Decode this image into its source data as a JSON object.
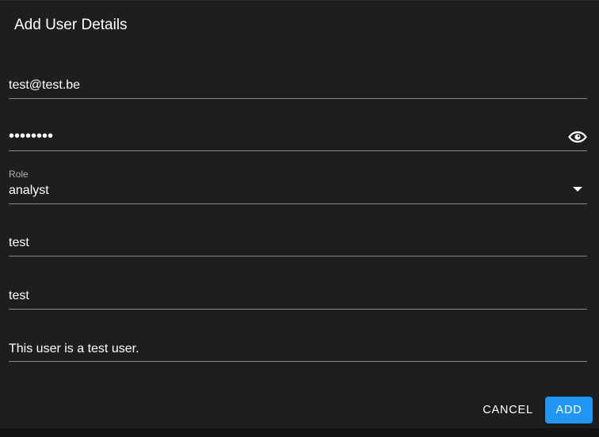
{
  "dialog": {
    "title": "Add User Details"
  },
  "form": {
    "email": {
      "value": "test@test.be"
    },
    "password": {
      "value": "••••••••",
      "visibility_icon": "eye-icon"
    },
    "role": {
      "label": "Role",
      "value": "analyst",
      "dropdown_icon": "caret-down-icon"
    },
    "first_name": {
      "value": "test"
    },
    "last_name": {
      "value": "test"
    },
    "description": {
      "value": "This user is a test user."
    }
  },
  "actions": {
    "cancel_label": "CANCEL",
    "add_label": "ADD"
  },
  "colors": {
    "background": "#1e1e1e",
    "outer_background": "#121212",
    "text": "#ffffff",
    "underline": "#8a8a8a",
    "label": "#b3b3b3",
    "primary": "#2196f3"
  }
}
